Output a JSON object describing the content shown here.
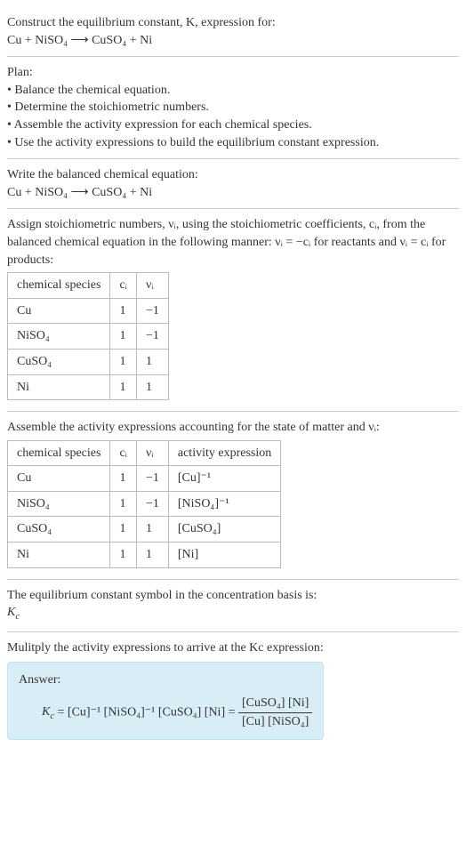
{
  "intro": {
    "prompt": "Construct the equilibrium constant, K, expression for:",
    "equation": "Cu + NiSO₄  ⟶  CuSO₄ + Ni"
  },
  "plan": {
    "title": "Plan:",
    "items": [
      "• Balance the chemical equation.",
      "• Determine the stoichiometric numbers.",
      "• Assemble the activity expression for each chemical species.",
      "• Use the activity expressions to build the equilibrium constant expression."
    ]
  },
  "balanced": {
    "title": "Write the balanced chemical equation:",
    "equation": "Cu + NiSO₄  ⟶  CuSO₄ + Ni"
  },
  "stoich": {
    "intro": "Assign stoichiometric numbers, νᵢ, using the stoichiometric coefficients, cᵢ, from the balanced chemical equation in the following manner: νᵢ = −cᵢ for reactants and νᵢ = cᵢ for products:",
    "headers": [
      "chemical species",
      "cᵢ",
      "νᵢ"
    ],
    "rows": [
      [
        "Cu",
        "1",
        "−1"
      ],
      [
        "NiSO₄",
        "1",
        "−1"
      ],
      [
        "CuSO₄",
        "1",
        "1"
      ],
      [
        "Ni",
        "1",
        "1"
      ]
    ]
  },
  "activity": {
    "intro": "Assemble the activity expressions accounting for the state of matter and νᵢ:",
    "headers": [
      "chemical species",
      "cᵢ",
      "νᵢ",
      "activity expression"
    ],
    "rows": [
      [
        "Cu",
        "1",
        "−1",
        "[Cu]⁻¹"
      ],
      [
        "NiSO₄",
        "1",
        "−1",
        "[NiSO₄]⁻¹"
      ],
      [
        "CuSO₄",
        "1",
        "1",
        "[CuSO₄]"
      ],
      [
        "Ni",
        "1",
        "1",
        "[Ni]"
      ]
    ]
  },
  "symbol": {
    "text": "The equilibrium constant symbol in the concentration basis is:",
    "sym": "K",
    "sub": "c"
  },
  "multiply": {
    "text": "Mulitply the activity expressions to arrive at the Kc expression:"
  },
  "answer": {
    "label": "Answer:",
    "lhs_prefix": "K",
    "lhs_sub": "c",
    "mid": " = [Cu]⁻¹ [NiSO₄]⁻¹ [CuSO₄] [Ni] = ",
    "num": "[CuSO₄] [Ni]",
    "den": "[Cu] [NiSO₄]"
  }
}
